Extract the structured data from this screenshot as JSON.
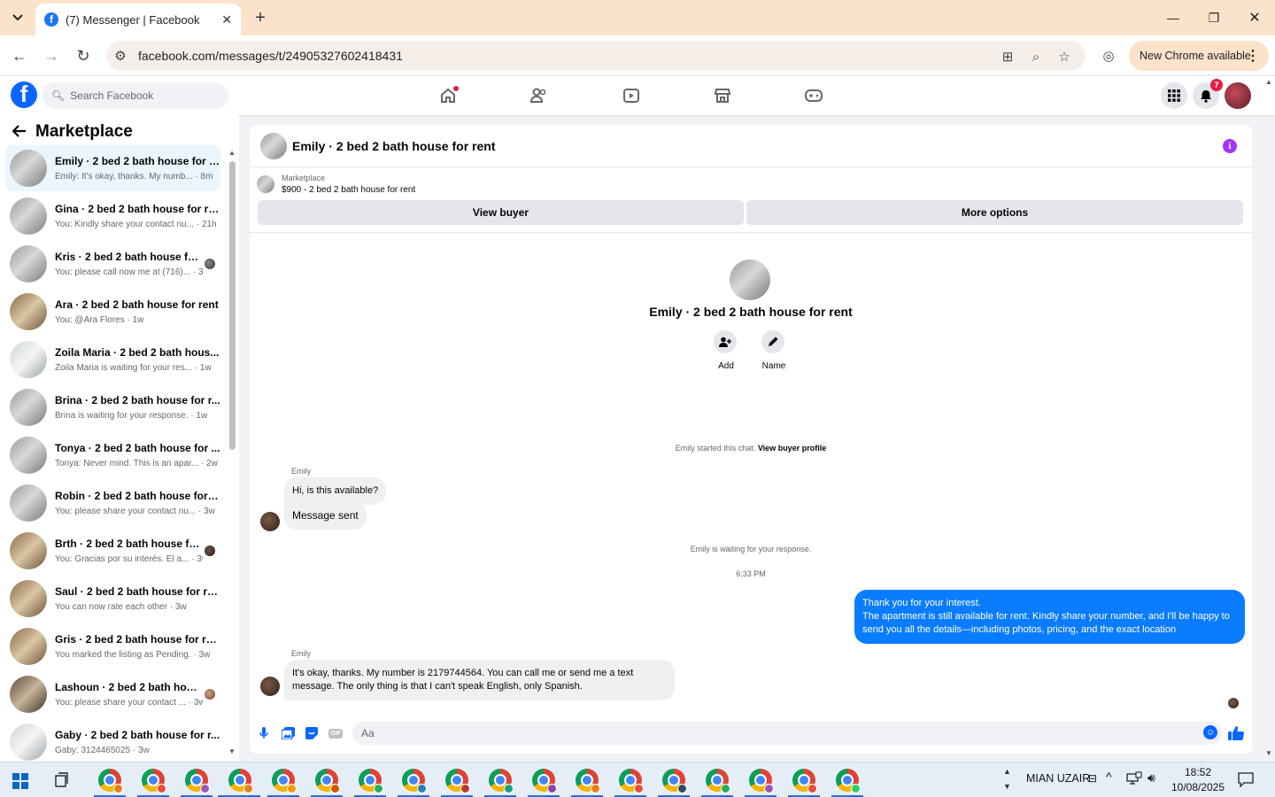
{
  "browser": {
    "tab_title": "(7) Messenger | Facebook",
    "tab_favicon": "f",
    "url": "facebook.com/messages/t/24905327602418431",
    "new_chrome_label": "New Chrome available"
  },
  "fb": {
    "search_placeholder": "Search Facebook",
    "notification_count": "7"
  },
  "sidebar": {
    "title": "Marketplace",
    "conversations": [
      {
        "name": "Emily · 2 bed 2 bath house for r...",
        "preview": "Emily: It's okay, thanks. My numb... · 8m"
      },
      {
        "name": "Gina · 2 bed 2 bath house for re...",
        "preview": "You: Kindly share your contact nu... · 21h"
      },
      {
        "name": "Kris · 2 bed 2 bath house for ...",
        "preview": "You: please call now me at (716)... · 3d"
      },
      {
        "name": "Ara · 2 bed 2 bath house for rent",
        "preview": "You: @Ara Flores · 1w"
      },
      {
        "name": "Zoila Maria · 2 bed 2 bath hous...",
        "preview": "Zoila Maria is waiting for your res... · 1w"
      },
      {
        "name": "Brina · 2 bed 2 bath house for r...",
        "preview": "Brina is waiting for your response. · 1w"
      },
      {
        "name": "Tonya · 2 bed 2 bath house for ...",
        "preview": "Tonya: Never mind. This is an apar... · 2w"
      },
      {
        "name": "Robin · 2 bed 2 bath house for r...",
        "preview": "You: please share your contact nu... · 3w"
      },
      {
        "name": "Brth · 2 bed 2 bath house for...",
        "preview": "You: Gracias por su interés. El a... · 3w"
      },
      {
        "name": "Saul · 2 bed 2 bath house for rent",
        "preview": "You can now rate each other · 3w"
      },
      {
        "name": "Gris · 2 bed 2 bath house for rent",
        "preview": "You marked the listing as Pending. · 3w"
      },
      {
        "name": "Lashoun · 2 bed 2 bath house...",
        "preview": "You: please share your contact ... · 3w"
      },
      {
        "name": "Gaby · 2 bed 2 bath house for r...",
        "preview": "Gaby: 3124465025 · 3w"
      }
    ]
  },
  "chat": {
    "header_name": "Emily · 2 bed 2 bath house for rent",
    "listing_source": "Marketplace",
    "listing_title": "$900 - 2 bed 2 bath house for rent",
    "view_buyer_label": "View buyer",
    "more_options_label": "More options",
    "intro_name": "Emily · 2 bed 2 bath house for rent",
    "add_label": "Add",
    "name_label": "Name",
    "started_text": "Emily started this chat.",
    "view_profile_link": "View buyer profile",
    "sender_1": "Emily",
    "msg_1": "Hi, is this available?",
    "msg_2": "Message sent",
    "waiting_text": "Emily is waiting for your response.",
    "timestamp": "6:33 PM",
    "my_msg_line1": "Thank you for your interest.",
    "my_msg_line2": "The apartment is still available for rent. Kindly share your number, and I'll be happy to send you all the details—including photos, pricing, and the exact location",
    "sender_2": "Emily",
    "msg_3": "It's okay, thanks. My number is 2179744564. You can call me or send me a text message. The only thing is that I can't speak English, only Spanish.",
    "composer_placeholder": "Aa",
    "gif_label": "GIF"
  },
  "taskbar": {
    "user_label": "MIAN UZAIR",
    "time": "18:52",
    "date": "10/08/2025"
  },
  "colors": {
    "accent": "#0866ff",
    "my_bubble": "#0a7cff",
    "info_icon": "#a033ff",
    "titlebar": "#fbe2cb"
  }
}
